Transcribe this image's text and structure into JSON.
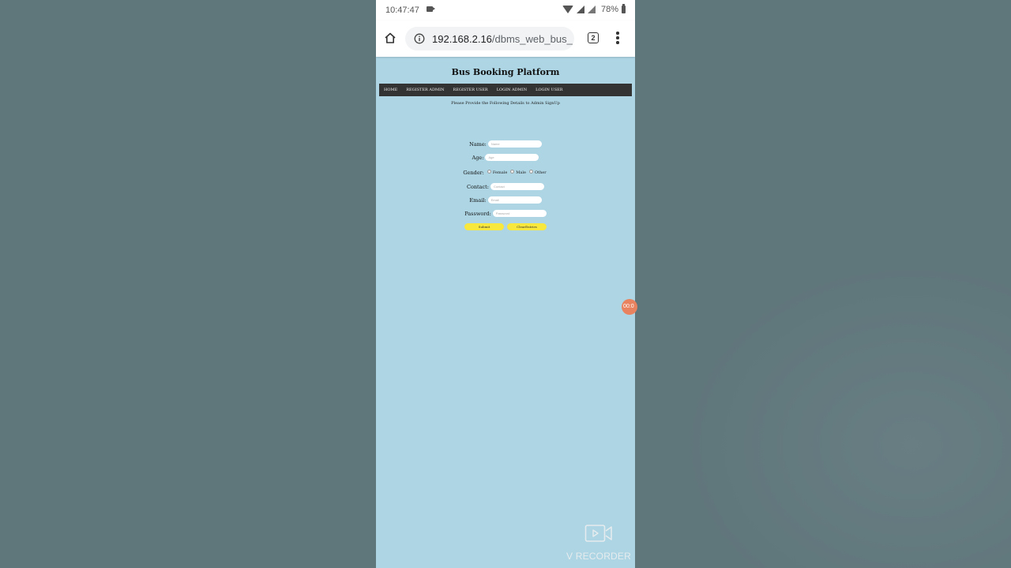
{
  "status_bar": {
    "time": "10:47:47",
    "battery": "78%"
  },
  "browser": {
    "url_host": "192.168.2.16",
    "url_path": "/dbms_web_bus_",
    "tab_count": "2"
  },
  "page": {
    "title": "Bus Booking Platform",
    "nav": [
      "HOME",
      "REGISTER ADMIN",
      "REGISTER USER",
      "LOGIN ADMIN",
      "LOGIN USER"
    ],
    "subtitle": "Please Provide the Following Details to Admin SignUp",
    "form": {
      "name_label": "Name:",
      "name_placeholder": "Name",
      "age_label": "Age:",
      "age_placeholder": "Age",
      "gender_label": "Gender:",
      "gender_options": [
        "Female",
        "Male",
        "Other"
      ],
      "contact_label": "Contact:",
      "contact_placeholder": "Contact",
      "email_label": "Email:",
      "email_placeholder": "Email",
      "password_label": "Password:",
      "password_placeholder": "Password",
      "submit_label": "Submit",
      "clear_label": "ClearEntries"
    }
  },
  "overlay": {
    "timer": "00:0",
    "recorder_label": "V RECORDER"
  }
}
